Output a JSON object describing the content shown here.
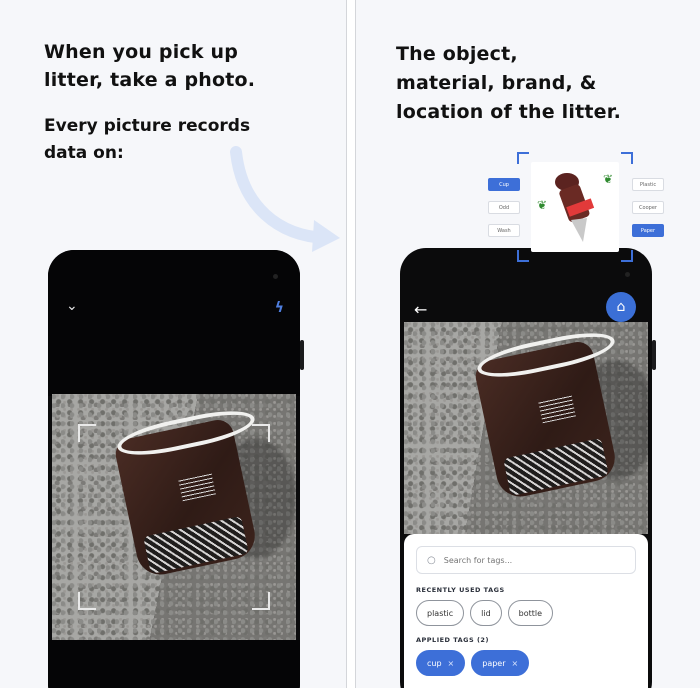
{
  "left_panel": {
    "headline_line1": "When you pick up",
    "headline_line2": "litter, take a photo.",
    "sub_line1": "Every picture records",
    "sub_line2": "data on:",
    "icons": {
      "collapse": "chevron-down-icon",
      "flash": "flash-icon"
    },
    "glyphs": {
      "collapse": "⌄",
      "flash": "ϟ"
    }
  },
  "right_panel": {
    "headline_line1": "The object,",
    "headline_line2": "material, brand, &",
    "headline_line3": "location of the litter.",
    "preview_tags_left": [
      {
        "label": "Cup",
        "selected": true
      },
      {
        "label": "Odd",
        "selected": false
      },
      {
        "label": "Wash",
        "selected": false
      }
    ],
    "preview_tags_right": [
      {
        "label": "Plastic",
        "selected": false
      },
      {
        "label": "Cooper",
        "selected": false
      },
      {
        "label": "Paper",
        "selected": true
      }
    ],
    "app": {
      "back_glyph": "←",
      "tag_glyph": "⌂",
      "search_placeholder": "Search for tags...",
      "search_glyph": "○",
      "recently_used_label": "RECENTLY USED TAGS",
      "recent_tags": [
        "plastic",
        "lid",
        "bottle"
      ],
      "applied_label": "APPLIED TAGS (2)",
      "applied_tags": [
        "cup",
        "paper"
      ],
      "remove_glyph": "×"
    }
  },
  "colors": {
    "accent": "#3d6fd8",
    "background": "#f6f7fa",
    "text": "#111111"
  }
}
